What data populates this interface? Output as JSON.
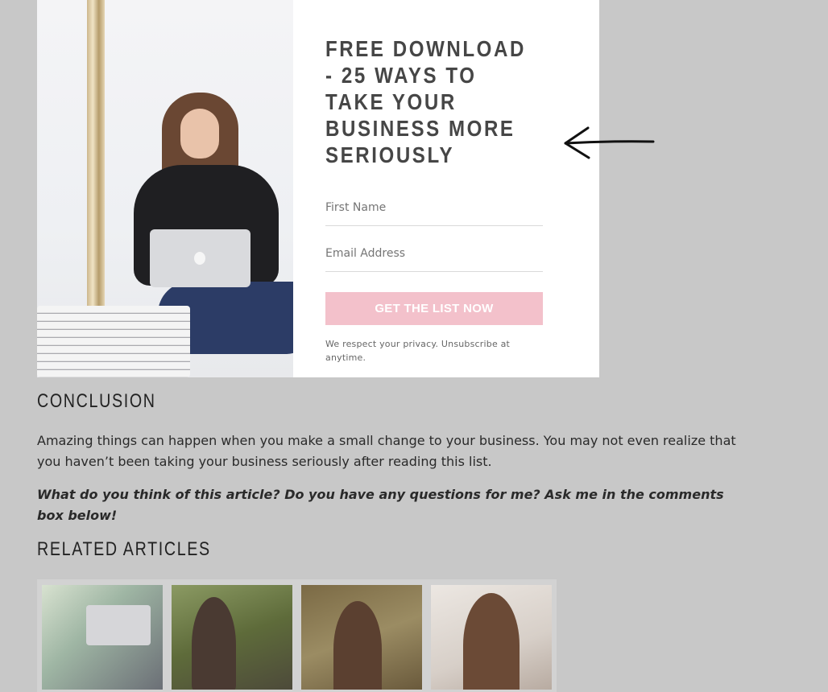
{
  "optin": {
    "title": "FREE DOWNLOAD - 25 WAYS TO TAKE YOUR BUSINESS MORE SERIOUSLY",
    "first_name_placeholder": "First Name",
    "email_placeholder": "Email Address",
    "button_label": "GET THE LIST NOW",
    "privacy_text": "We respect your privacy. Unsubscribe at anytime.",
    "button_color": "#f3c1cb"
  },
  "conclusion": {
    "heading": "CONCLUSION",
    "paragraph": "Amazing things can happen when you make a small change to your business. You may not even realize that you haven’t been taking your business seriously after reading this list.",
    "question": "What do you think of this article? Do you have any questions for me? Ask me in the comments box below!"
  },
  "related": {
    "heading": "RELATED ARTICLES"
  },
  "icons": {
    "arrow": "left-arrow-icon"
  },
  "colors": {
    "page_background": "#c8c8c8",
    "card_background": "#ffffff",
    "heading_text": "#464646"
  }
}
